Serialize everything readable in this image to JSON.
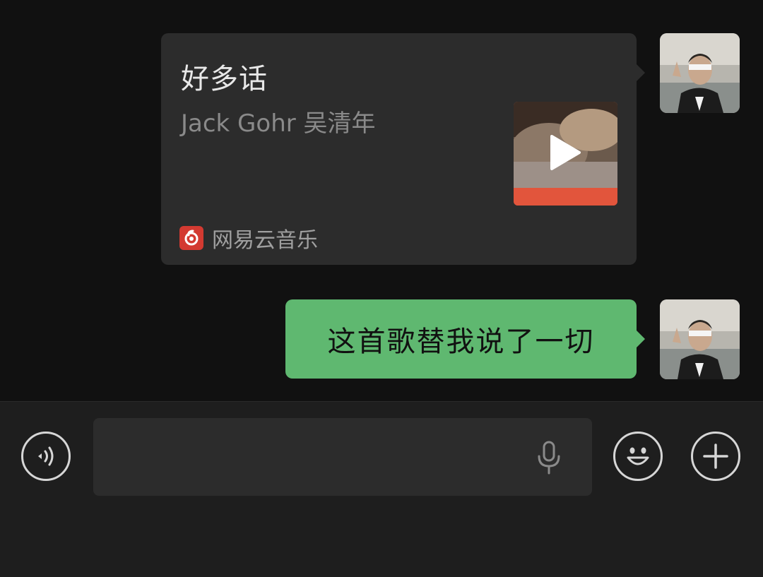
{
  "messages": [
    {
      "type": "music-card",
      "sender": "self",
      "song_title": "好多话",
      "artist": "Jack Gohr 吴清年",
      "source_app": "网易云音乐",
      "source_icon": "netease-cloud-music-icon"
    },
    {
      "type": "text",
      "sender": "self",
      "text": "这首歌替我说了一切"
    }
  ],
  "input_bar": {
    "voice_icon": "voice-mode-icon",
    "mic_icon": "microphone-icon",
    "emoji_icon": "emoji-icon",
    "more_icon": "plus-icon",
    "input_value": ""
  },
  "colors": {
    "background": "#111111",
    "card_background": "#2c2c2c",
    "bubble_green": "#5fb870",
    "netease_red": "#d33a31",
    "input_bar": "#1e1e1e"
  }
}
